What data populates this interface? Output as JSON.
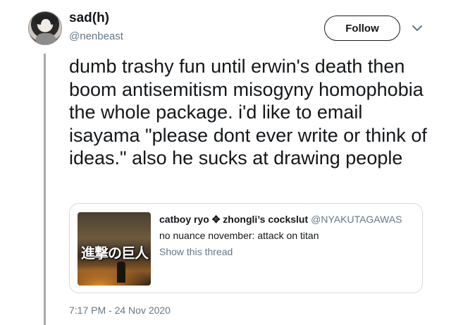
{
  "user": {
    "display_name": "sad(h)",
    "handle": "@nenbeast"
  },
  "follow_label": "Follow",
  "tweet": {
    "text": "dumb trashy fun until erwin's death then boom antisemitism misogyny homophobia the whole package. i'd like to email isayama \"please dont ever write or think of ideas.\" also he sucks at drawing people",
    "timestamp": "7:17 PM - 24 Nov 2020"
  },
  "quote": {
    "author_name": "catboy ryo ✥ zhongli’s cockslut",
    "author_handle": "@NYAKUTAGAWAS",
    "text": "no nuance november: attack on titan",
    "show_thread": "Show this thread",
    "thumbnail_title": "進撃の巨人"
  },
  "icons": {
    "avatar": "avatar-image",
    "chevron": "chevron-down-icon"
  }
}
